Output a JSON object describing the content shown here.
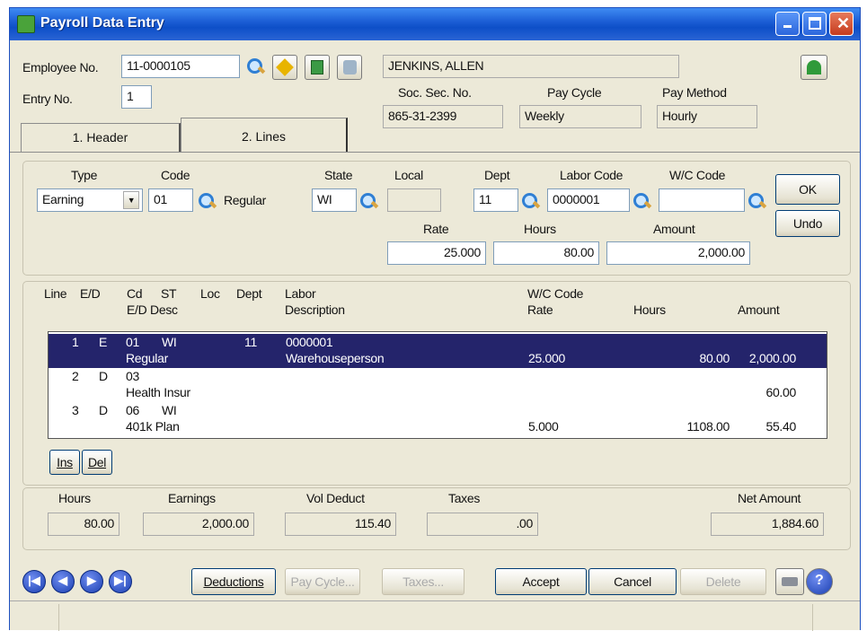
{
  "window": {
    "title": "Payroll Data Entry"
  },
  "header": {
    "employee_no_label": "Employee No.",
    "employee_no": "11-0000105",
    "employee_name": "JENKINS, ALLEN",
    "entry_no_label": "Entry No.",
    "entry_no": "1",
    "ssn_label": "Soc. Sec. No.",
    "ssn": "865-31-2399",
    "pay_cycle_label": "Pay Cycle",
    "pay_cycle": "Weekly",
    "pay_method_label": "Pay Method",
    "pay_method": "Hourly"
  },
  "tabs": [
    {
      "label": "1. Header"
    },
    {
      "label": "2. Lines"
    }
  ],
  "line_entry": {
    "type_label": "Type",
    "type": "Earning",
    "code_label": "Code",
    "code": "01",
    "code_desc": "Regular",
    "state_label": "State",
    "state": "WI",
    "local_label": "Local",
    "local": "",
    "dept_label": "Dept",
    "dept": "11",
    "labor_code_label": "Labor Code",
    "labor_code": "0000001",
    "wc_code_label": "W/C Code",
    "wc_code": "",
    "rate_label": "Rate",
    "rate": "25.000",
    "hours_label": "Hours",
    "hours": "80.00",
    "amount_label": "Amount",
    "amount": "2,000.00",
    "ok_label": "OK",
    "undo_label": "Undo"
  },
  "grid": {
    "headers": {
      "line": "Line",
      "ed": "E/D",
      "cd": "Cd",
      "st": "ST",
      "loc": "Loc",
      "dept": "Dept",
      "ed_desc": "E/D Desc",
      "labor": "Labor",
      "labor_desc": "Description",
      "wc_code": "W/C Code",
      "rate": "Rate",
      "hours": "Hours",
      "amount": "Amount"
    },
    "rows": [
      {
        "line": "1",
        "ed": "E",
        "cd": "01",
        "st": "WI",
        "dept": "11",
        "labor": "0000001",
        "desc": "Regular",
        "labor_desc": "Warehouseperson",
        "rate": "25.000",
        "hours": "80.00",
        "amount": "2,000.00"
      },
      {
        "line": "2",
        "ed": "D",
        "cd": "03",
        "st": "",
        "dept": "",
        "labor": "",
        "desc": "Health Insur",
        "labor_desc": "",
        "rate": "",
        "hours": "",
        "amount": "60.00"
      },
      {
        "line": "3",
        "ed": "D",
        "cd": "06",
        "st": "WI",
        "dept": "",
        "labor": "",
        "desc": "401k Plan",
        "labor_desc": "",
        "rate": "5.000",
        "hours": "1108.00",
        "amount": "55.40"
      }
    ],
    "ins_label": "Ins",
    "del_label": "Del"
  },
  "totals": {
    "hours_label": "Hours",
    "hours": "80.00",
    "earnings_label": "Earnings",
    "earnings": "2,000.00",
    "vol_deduct_label": "Vol Deduct",
    "vol_deduct": "115.40",
    "taxes_label": "Taxes",
    "taxes": ".00",
    "net_label": "Net Amount",
    "net": "1,884.60"
  },
  "footer": {
    "deductions_label": "Deductions",
    "pay_cycle_label": "Pay Cycle...",
    "taxes_label": "Taxes...",
    "accept_label": "Accept",
    "cancel_label": "Cancel",
    "delete_label": "Delete"
  },
  "colors": {
    "titlebar": "#0d4fc8",
    "selection": "#24246b",
    "face": "#ece9d8"
  }
}
